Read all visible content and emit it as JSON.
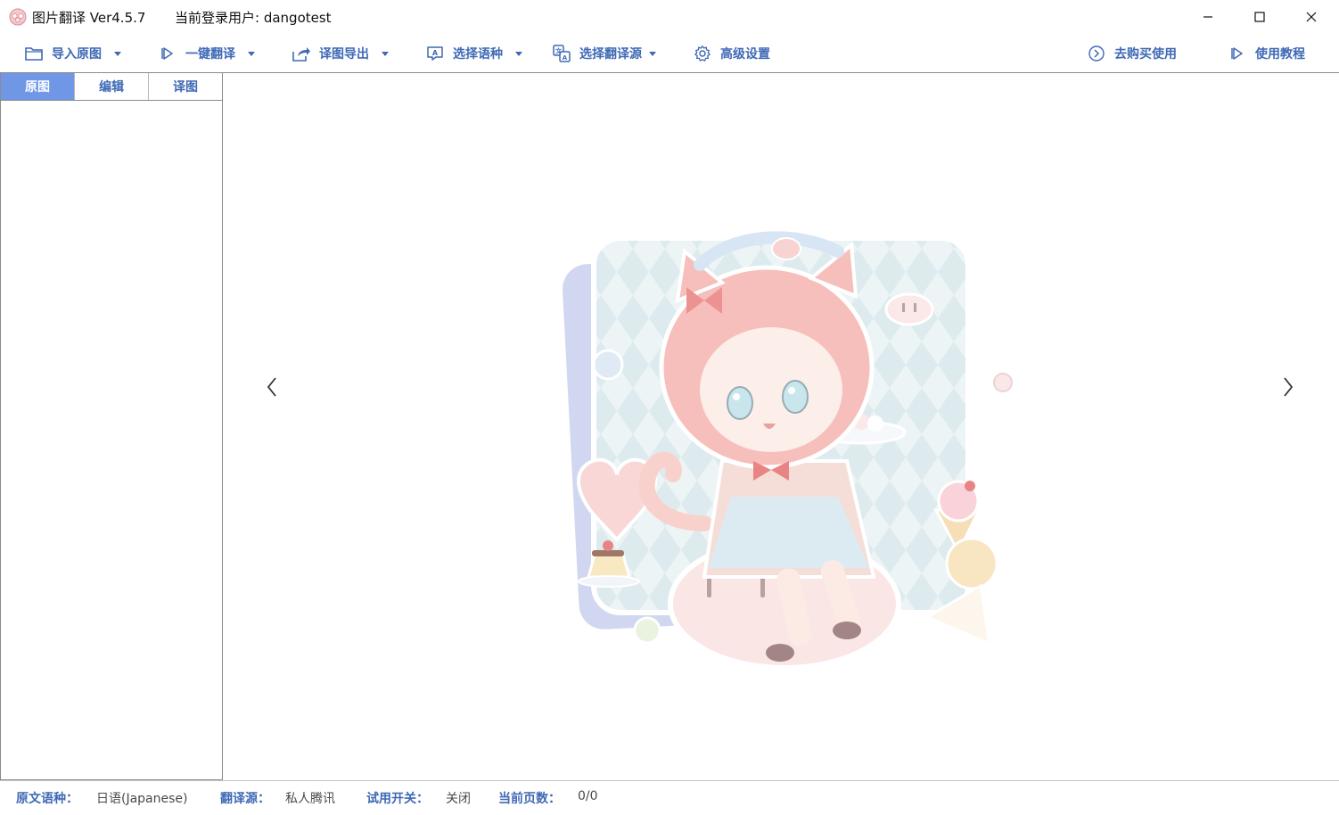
{
  "window": {
    "title": "图片翻译 Ver4.5.7",
    "user_label": "当前登录用户: dangotest"
  },
  "toolbar": {
    "import": "导入原图",
    "translate": "一键翻译",
    "export": "译图导出",
    "language": "选择语种",
    "source": "选择翻译源",
    "settings": "高级设置",
    "buy": "去购买使用",
    "tutorial": "使用教程"
  },
  "tabs": {
    "original": "原图",
    "edit": "编辑",
    "translated": "译图"
  },
  "status": {
    "lang_label": "原文语种：",
    "lang_value": "日语(Japanese)",
    "source_label": "翻译源：",
    "source_value": "私人腾讯",
    "trial_label": "试用开关：",
    "trial_value": "关闭",
    "page_label": "当前页数：",
    "page_value": "0/0"
  },
  "colors": {
    "accent": "#3f69b5",
    "active_tab": "#6f97e6"
  }
}
